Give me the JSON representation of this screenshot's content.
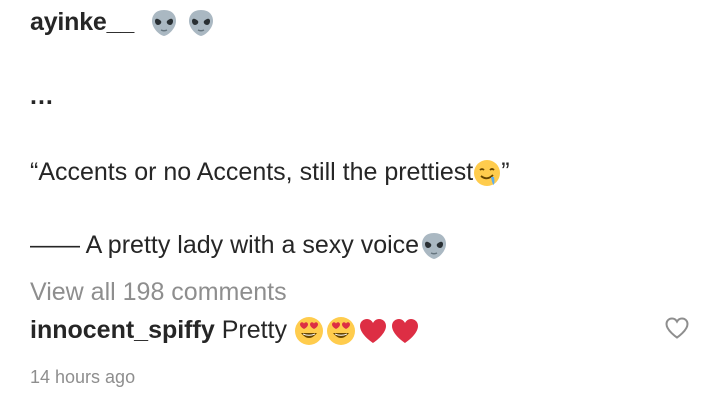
{
  "post": {
    "username": "ayinke__",
    "ellipsis": "...",
    "caption_line1": "“Accents or no Accents, still the prettiest",
    "caption_line1_end": "”",
    "caption_line2": "—— A pretty lady with a sexy voice",
    "view_all": "View all 198 comments"
  },
  "comment": {
    "username": "innocent_spiffy",
    "text": " Pretty ",
    "timestamp": "14 hours ago"
  },
  "icons": {
    "alien": "alien-icon",
    "drool": "drooling-face-icon",
    "heart_eyes": "heart-eyes-icon",
    "red_heart": "red-heart-icon",
    "like": "heart-outline-icon"
  },
  "colors": {
    "text": "#262626",
    "secondary": "#8e8e8e",
    "emoji_red": "#dd2e44",
    "emoji_yellow": "#ffcc4d"
  }
}
